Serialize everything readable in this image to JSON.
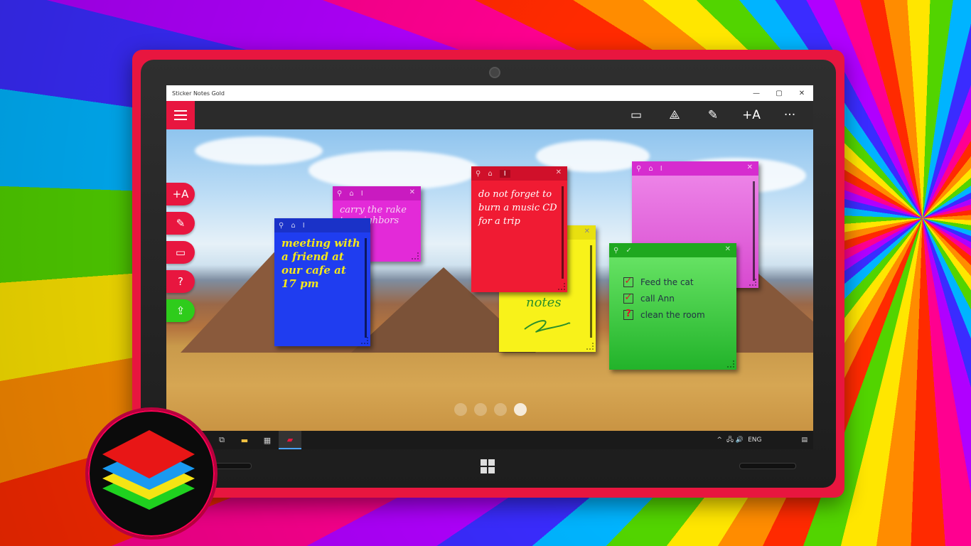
{
  "window": {
    "title": "Sticker Notes Gold",
    "minimize": "—",
    "restore": "▢",
    "close": "✕"
  },
  "appbar": {
    "icons": [
      "screen-edit-icon",
      "share-icon",
      "new-note-icon",
      "add-text-icon",
      "more-icon"
    ],
    "glyphs": [
      "▭",
      "⟁",
      "✎",
      "+A",
      "···"
    ]
  },
  "side_buttons": [
    {
      "name": "add-text-icon",
      "glyph": "+A"
    },
    {
      "name": "new-note-icon",
      "glyph": "✎"
    },
    {
      "name": "screen-edit-icon",
      "glyph": "▭"
    },
    {
      "name": "help-icon",
      "glyph": "?"
    },
    {
      "name": "share-icon",
      "glyph": "⇪"
    }
  ],
  "notes": {
    "pink": {
      "text": "carry the rake to neighbors",
      "color": "#e32ad8"
    },
    "blue": {
      "text": "meeting with a friend at our cafe at 17 pm",
      "color": "#1f3df0"
    },
    "red": {
      "text": "do not forget to burn a music CD for a trip",
      "color": "#f01b33"
    },
    "yellow": {
      "text": "notes",
      "color": "#f8f21a"
    },
    "magenta": {
      "text": "",
      "color": "#e44bdc"
    },
    "green": {
      "color": "#38cc3a",
      "items": [
        "Feed the cat",
        "call Ann",
        "clean the room"
      ],
      "checks": [
        "✓",
        "✓",
        "?"
      ]
    }
  },
  "note_bar": {
    "pin": "⚲",
    "lock": "⌂",
    "text": "I",
    "close": "✕"
  },
  "taskbar": {
    "items": [
      "task-view-icon",
      "file-explorer-icon",
      "store-icon",
      "sticker-notes-icon"
    ],
    "glyphs": [
      "⧉",
      "▬",
      "▦",
      "▰"
    ],
    "tray_chevron": "^",
    "tray_icons": "🖧 🔊",
    "language": "ENG",
    "notification": "▤"
  },
  "pager": {
    "count": 4,
    "active_index": 3
  }
}
